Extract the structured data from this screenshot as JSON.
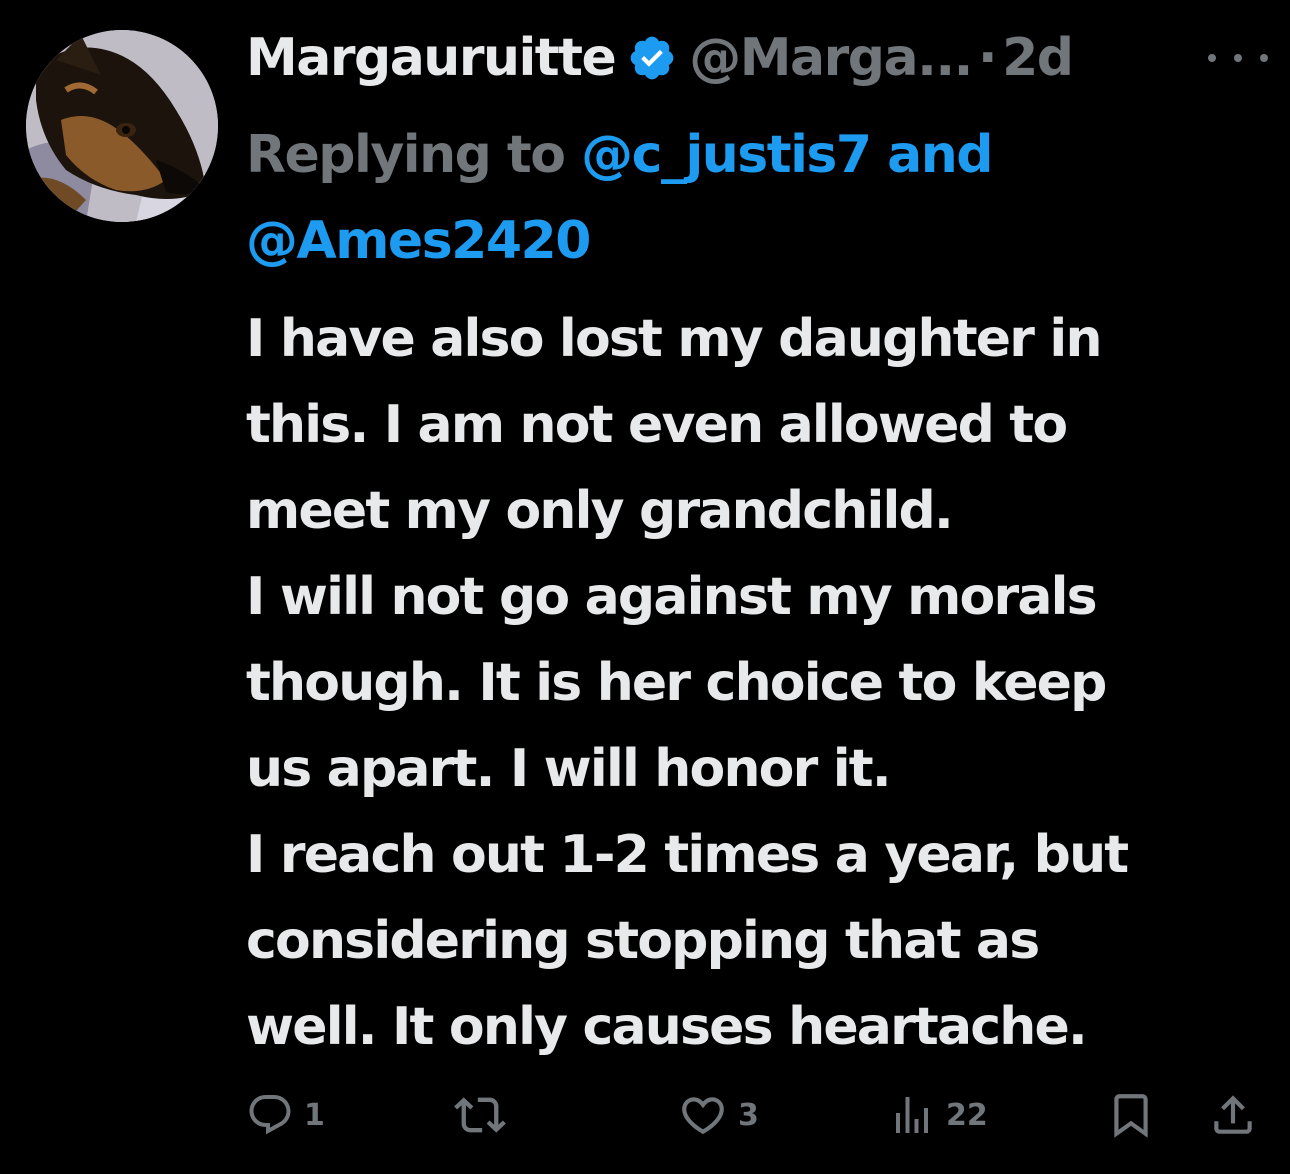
{
  "tweet": {
    "display_name": "Margauruitte",
    "handle": "@Marga...",
    "separator": "·",
    "timestamp": "2d",
    "reply_prefix": "Replying to",
    "reply_mention_1": "@c_justis7",
    "reply_and": "and",
    "reply_mention_2": "@Ames2420",
    "body_lines": [
      "I have also lost my daughter in",
      "this. I am not even allowed to",
      "meet my only grandchild.",
      "I will not go against my morals",
      "though. It is her choice to keep",
      "us apart. I will honor it.",
      "I reach out 1-2 times a year, but",
      "considering stopping that as",
      "well. It only causes heartache."
    ]
  },
  "actions": {
    "replies": "1",
    "retweets": "",
    "likes": "3",
    "views": "22"
  },
  "icons": {
    "verified": "verified-badge-icon",
    "more": "more-dots-icon",
    "reply": "reply-bubble-icon",
    "retweet": "retweet-icon",
    "like": "heart-icon",
    "views": "analytics-bars-icon",
    "bookmark": "bookmark-icon",
    "share": "share-upload-icon"
  },
  "colors": {
    "background": "#000000",
    "text": "#e7e9ea",
    "muted": "#71767b",
    "accent": "#1d9bf0"
  }
}
